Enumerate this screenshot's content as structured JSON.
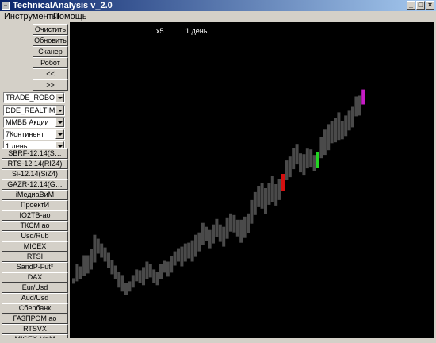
{
  "window": {
    "title": "TechnicalAnalysis v_2.0"
  },
  "menu": {
    "items": [
      "Инструменты",
      "Помощь"
    ]
  },
  "toolbar": {
    "buttons": [
      "Очистить",
      "Обновить",
      "Сканер",
      "Робот",
      "<<",
      ">>"
    ]
  },
  "selectors": [
    {
      "value": "TRADE_ROBOT"
    },
    {
      "value": "DDE_REALTIME"
    },
    {
      "value": "ММВБ Акции"
    },
    {
      "value": "7Континент"
    },
    {
      "value": "1 день"
    }
  ],
  "instruments": [
    "SBRF-12.14(S…",
    "RTS-12.14(RIZ4)",
    "Si-12.14(SiZ4)",
    "GAZR-12.14(G…",
    "iМедиаВиМ",
    "ПроектИ",
    "IO2TB-ао",
    "ТКСМ ао",
    "Usd/Rub",
    "MICEX",
    "RTSI",
    "SandP-Fut*",
    "DAX",
    "Eur/Usd",
    "Aud/Usd",
    "Сбербанк",
    "ГАЗПРОМ ао",
    "RTSVX",
    "MICEX MnM"
  ],
  "chart_header": {
    "zoom": "x5",
    "period": "1 день"
  },
  "chart_data": {
    "type": "bar",
    "title": "",
    "xlabel": "",
    "ylabel": "",
    "ylim": [
      0,
      400
    ],
    "colors": {
      "normal": "#4a4a4a",
      "red": "#d41010",
      "green": "#22d422",
      "magenta": "#c61cc6",
      "background": "#000000"
    },
    "bars": [
      [
        69,
        76,
        "n"
      ],
      [
        72,
        94,
        "n"
      ],
      [
        75,
        91,
        "n"
      ],
      [
        79,
        105,
        "n"
      ],
      [
        82,
        105,
        "n"
      ],
      [
        87,
        113,
        "n"
      ],
      [
        96,
        131,
        "n"
      ],
      [
        107,
        126,
        "n"
      ],
      [
        102,
        120,
        "n"
      ],
      [
        97,
        115,
        "n"
      ],
      [
        89,
        108,
        "n"
      ],
      [
        81,
        99,
        "n"
      ],
      [
        75,
        92,
        "n"
      ],
      [
        64,
        84,
        "n"
      ],
      [
        59,
        80,
        "n"
      ],
      [
        55,
        70,
        "n"
      ],
      [
        59,
        72,
        "n"
      ],
      [
        64,
        80,
        "n"
      ],
      [
        72,
        87,
        "n"
      ],
      [
        70,
        86,
        "n"
      ],
      [
        67,
        90,
        "n"
      ],
      [
        75,
        97,
        "n"
      ],
      [
        77,
        94,
        "n"
      ],
      [
        70,
        87,
        "n"
      ],
      [
        67,
        84,
        "n"
      ],
      [
        75,
        94,
        "n"
      ],
      [
        83,
        98,
        "n"
      ],
      [
        78,
        97,
        "n"
      ],
      [
        83,
        104,
        "n"
      ],
      [
        92,
        110,
        "n"
      ],
      [
        97,
        114,
        "n"
      ],
      [
        91,
        116,
        "n"
      ],
      [
        97,
        120,
        "n"
      ],
      [
        101,
        121,
        "n"
      ],
      [
        97,
        124,
        "n"
      ],
      [
        103,
        131,
        "n"
      ],
      [
        110,
        134,
        "n"
      ],
      [
        118,
        146,
        "n"
      ],
      [
        123,
        141,
        "n"
      ],
      [
        114,
        137,
        "n"
      ],
      [
        120,
        144,
        "n"
      ],
      [
        128,
        151,
        "n"
      ],
      [
        122,
        144,
        "n"
      ],
      [
        116,
        141,
        "n"
      ],
      [
        126,
        153,
        "n"
      ],
      [
        135,
        158,
        "n"
      ],
      [
        134,
        156,
        "n"
      ],
      [
        129,
        150,
        "n"
      ],
      [
        121,
        150,
        "n"
      ],
      [
        127,
        154,
        "n"
      ],
      [
        133,
        158,
        "n"
      ],
      [
        145,
        175,
        "n"
      ],
      [
        156,
        185,
        "n"
      ],
      [
        166,
        193,
        "n"
      ],
      [
        164,
        196,
        "n"
      ],
      [
        157,
        190,
        "n"
      ],
      [
        169,
        196,
        "n"
      ],
      [
        172,
        205,
        "n"
      ],
      [
        168,
        195,
        "n"
      ],
      [
        175,
        201,
        "n"
      ],
      [
        186,
        208,
        "r"
      ],
      [
        200,
        225,
        "n"
      ],
      [
        204,
        230,
        "n"
      ],
      [
        214,
        241,
        "n"
      ],
      [
        220,
        246,
        "n"
      ],
      [
        210,
        234,
        "n"
      ],
      [
        206,
        233,
        "n"
      ],
      [
        215,
        240,
        "n"
      ],
      [
        217,
        239,
        "n"
      ],
      [
        212,
        232,
        "n"
      ],
      [
        216,
        236,
        "g"
      ],
      [
        228,
        255,
        "n"
      ],
      [
        232,
        264,
        "n"
      ],
      [
        238,
        271,
        "n"
      ],
      [
        247,
        275,
        "n"
      ],
      [
        248,
        279,
        "n"
      ],
      [
        251,
        286,
        "n"
      ],
      [
        252,
        275,
        "n"
      ],
      [
        256,
        282,
        "n"
      ],
      [
        263,
        288,
        "n"
      ],
      [
        267,
        293,
        "n"
      ],
      [
        281,
        306,
        "n"
      ],
      [
        282,
        307,
        "n"
      ],
      [
        296,
        315,
        "m"
      ]
    ]
  }
}
